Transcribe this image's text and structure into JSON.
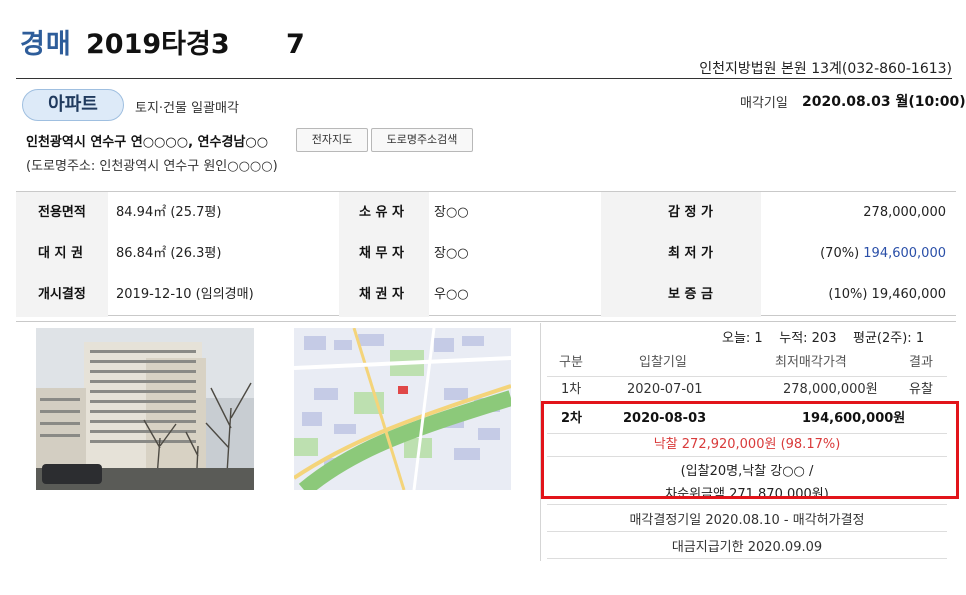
{
  "header": {
    "case_kind": "경매",
    "case_number": "2019타경3      7",
    "court": "인천지방법원 본원 13계(032-860-1613)"
  },
  "property": {
    "type": "아파트",
    "sale_type": "토지·건물 일괄매각",
    "sale_date_label": "매각기일",
    "sale_date": "2020.08.03 월(10:00)",
    "address": "인천광역시 연수구 연○○○○, 연수경남○○",
    "btn_map": "전자지도",
    "btn_road": "도로명주소검색",
    "road_address": "(도로명주소: 인천광역시 연수구 원인○○○○)"
  },
  "info": {
    "rows": [
      [
        "전용면적",
        "84.94㎡ (25.7평)",
        "소 유 자",
        "장○○",
        "감 정 가",
        "278,000,000"
      ],
      [
        "대 지 권",
        "86.84㎡ (26.3평)",
        "채 무 자",
        "장○○",
        "최 저 가",
        "(70%) "
      ],
      [
        "개시결정",
        "2019-12-10 (임의경매)",
        "채 권 자",
        "우○○",
        "보 증 금",
        "(10%) 19,460,000"
      ]
    ],
    "min_price_highlight": "194,600,000"
  },
  "stats": {
    "text": "오늘: 1    누적: 203    평균(2주): 1"
  },
  "bids": {
    "headers": [
      "구분",
      "입찰기일",
      "최저매각가격",
      "결과"
    ],
    "rows": [
      {
        "round": "1차",
        "date": "2020-07-01",
        "price": "278,000,000원",
        "result": "유찰"
      },
      {
        "round": "2차",
        "date": "2020-08-03",
        "price": "194,600,000원",
        "result": ""
      }
    ],
    "sold": "낙찰 272,920,000원 (98.17%)",
    "bid_info_1": "(입찰20명,낙찰 강○○ /",
    "bid_info_2": "차순위금액 271,870,000원)",
    "decision": "매각결정기일 2020.08.10 - 매각허가결정",
    "deadline": "대금지급기한 2020.09.09"
  },
  "colors": {
    "brand": "#2e5d9a",
    "highlight": "#e2141a",
    "sold": "#d93b3b",
    "price_blue": "#2a4fa8"
  }
}
